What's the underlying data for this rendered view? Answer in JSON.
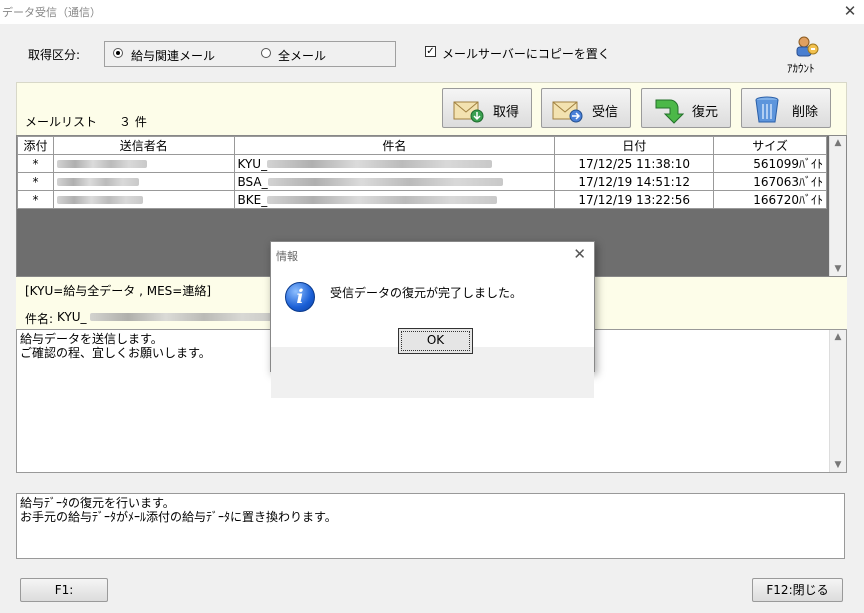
{
  "window": {
    "title": "データ受信（通信）",
    "close": "✕"
  },
  "options": {
    "acquire_label": "取得区分:",
    "radio_salary": "給与関連メール",
    "radio_all": "全メール",
    "copy_checkbox": "メールサーバーにコピーを置く",
    "copy_checked": true,
    "selected_radio": "salary"
  },
  "account": {
    "label": "ｱｶｳﾝﾄ"
  },
  "list": {
    "label": "メールリスト",
    "count": "３ 件"
  },
  "toolbar": {
    "acquire": "取得",
    "receive": "受信",
    "restore": "復元",
    "delete": "削除"
  },
  "table": {
    "headers": [
      "添付",
      "送信者名",
      "件名",
      "日付",
      "サイズ"
    ],
    "rows": [
      {
        "attach": "*",
        "subject_prefix": "KYU_",
        "date": "17/12/25 11:38:10",
        "size": "561099ﾊﾞｲﾄ"
      },
      {
        "attach": "*",
        "subject_prefix": "BSA_",
        "date": "17/12/19 14:51:12",
        "size": "167063ﾊﾞｲﾄ"
      },
      {
        "attach": "*",
        "subject_prefix": "BKE_",
        "date": "17/12/19 13:22:56",
        "size": "166720ﾊﾞｲﾄ"
      }
    ]
  },
  "legend": "[KYU=給与全データ , MES=連絡]",
  "subject_line": {
    "label": "件名:",
    "prefix": "KYU_"
  },
  "message_body": "給与データを送信します。\nご確認の程、宜しくお願いします。",
  "status_text": "給与ﾃﾞｰﾀの復元を行います。\nお手元の給与ﾃﾞｰﾀがﾒｰﾙ添付の給与ﾃﾞｰﾀに置き換わります。",
  "footer": {
    "f1": "F1:",
    "f12": "F12:閉じる"
  },
  "dialog": {
    "title": "情報",
    "message": "受信データの復元が完了しました。",
    "ok": "OK",
    "close": "✕"
  }
}
